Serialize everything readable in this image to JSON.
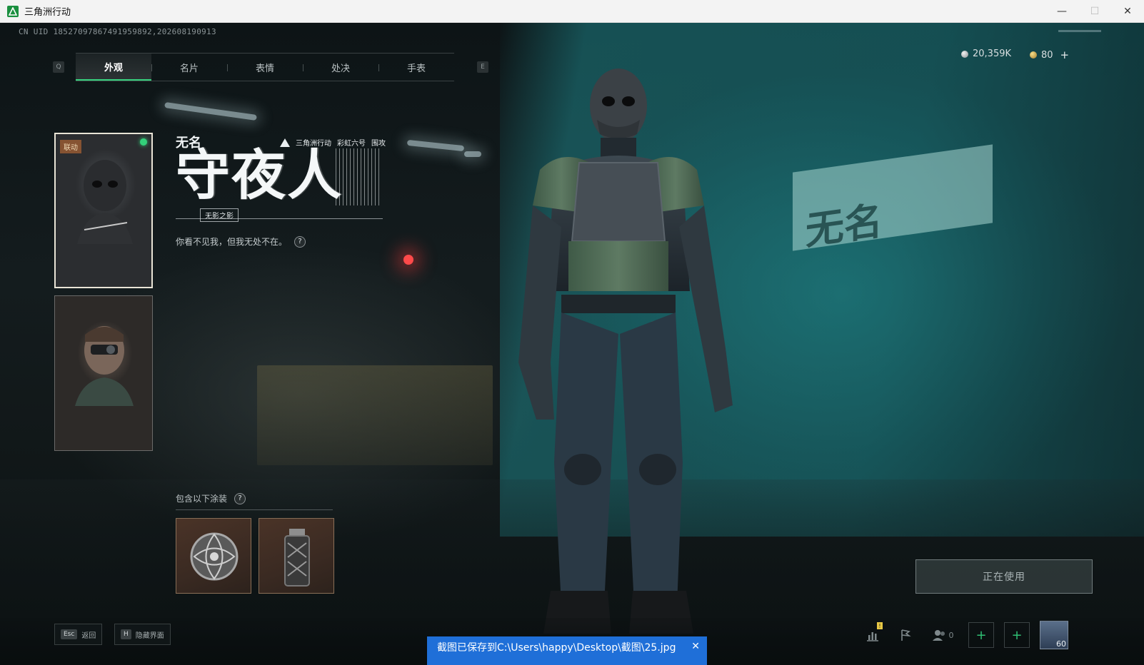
{
  "window": {
    "title": "三角洲行动",
    "controls": {
      "minimize": "—",
      "maximize": "☐",
      "close": "✕"
    }
  },
  "uid": "CN UID 18527097867491959892,202608190913",
  "tabs": {
    "key_prev": "Q",
    "key_next": "E",
    "items": [
      {
        "label": "外观",
        "active": true
      },
      {
        "label": "名片",
        "active": false
      },
      {
        "label": "表情",
        "active": false
      },
      {
        "label": "处决",
        "active": false
      },
      {
        "label": "手表",
        "active": false
      }
    ]
  },
  "currency": {
    "silver": "20,359K",
    "gold": "80",
    "add": "+"
  },
  "skins": {
    "card1_tag": "联动"
  },
  "showcase": {
    "character_name": "无名",
    "brand": "三角洲行动",
    "collab": "彩虹六号",
    "collab_sub": "围攻",
    "skin_title": "守夜人",
    "skin_subtitle": "无影之影",
    "tagline": "你看不见我，但我无处不在。",
    "help": "?"
  },
  "wall_text": "无名",
  "includes": {
    "label": "包含以下涂装",
    "help": "?"
  },
  "in_use_button": "正在使用",
  "hotkeys": {
    "esc_key": "Esc",
    "esc_label": "返回",
    "h_key": "H",
    "h_label": "隐藏界面"
  },
  "social": {
    "warn_badge": "!",
    "friend_count": "0",
    "add": "+",
    "level": "60"
  },
  "toast": {
    "message": "截图已保存到C:\\Users\\happy\\Desktop\\截图\\25.jpg",
    "close": "✕"
  },
  "colors": {
    "accent_green": "#37d37f",
    "toast_blue": "#1f6fd8",
    "teal_wall": "#1e8286"
  }
}
